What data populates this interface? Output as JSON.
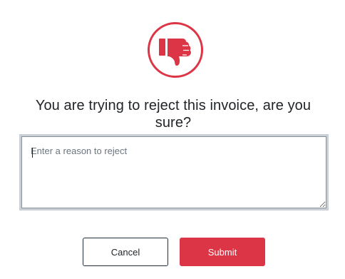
{
  "dialog": {
    "icon": "thumbs-down-icon",
    "accent_color": "#dc3545",
    "title": "You are trying to reject this invoice, are you sure?",
    "reason": {
      "value": "",
      "placeholder": "Enter a reason to reject"
    },
    "buttons": {
      "cancel_label": "Cancel",
      "submit_label": "Submit"
    }
  }
}
